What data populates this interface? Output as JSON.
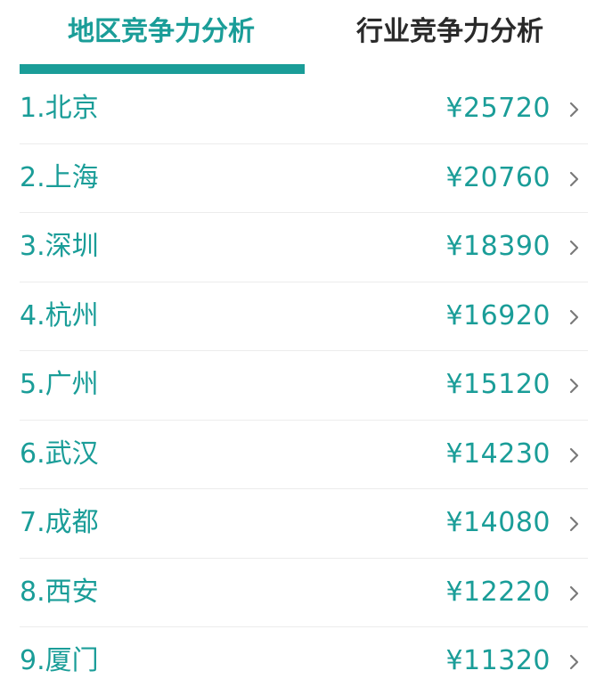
{
  "tabs": {
    "active_label": "地区竞争力分析",
    "inactive_label": "行业竞争力分析"
  },
  "colors": {
    "accent": "#1a9d98",
    "text_dark": "#2a2a2a",
    "divider": "#ececec",
    "chevron": "#7a7a7a"
  },
  "list": {
    "items": [
      {
        "label": "1.北京",
        "value": "¥25720"
      },
      {
        "label": "2.上海",
        "value": "¥20760"
      },
      {
        "label": "3.深圳",
        "value": "¥18390"
      },
      {
        "label": "4.杭州",
        "value": "¥16920"
      },
      {
        "label": "5.广州",
        "value": "¥15120"
      },
      {
        "label": "6.武汉",
        "value": "¥14230"
      },
      {
        "label": "7.成都",
        "value": "¥14080"
      },
      {
        "label": "8.西安",
        "value": "¥12220"
      },
      {
        "label": "9.厦门",
        "value": "¥11320"
      }
    ],
    "row_icon": "chevron-right-icon"
  }
}
